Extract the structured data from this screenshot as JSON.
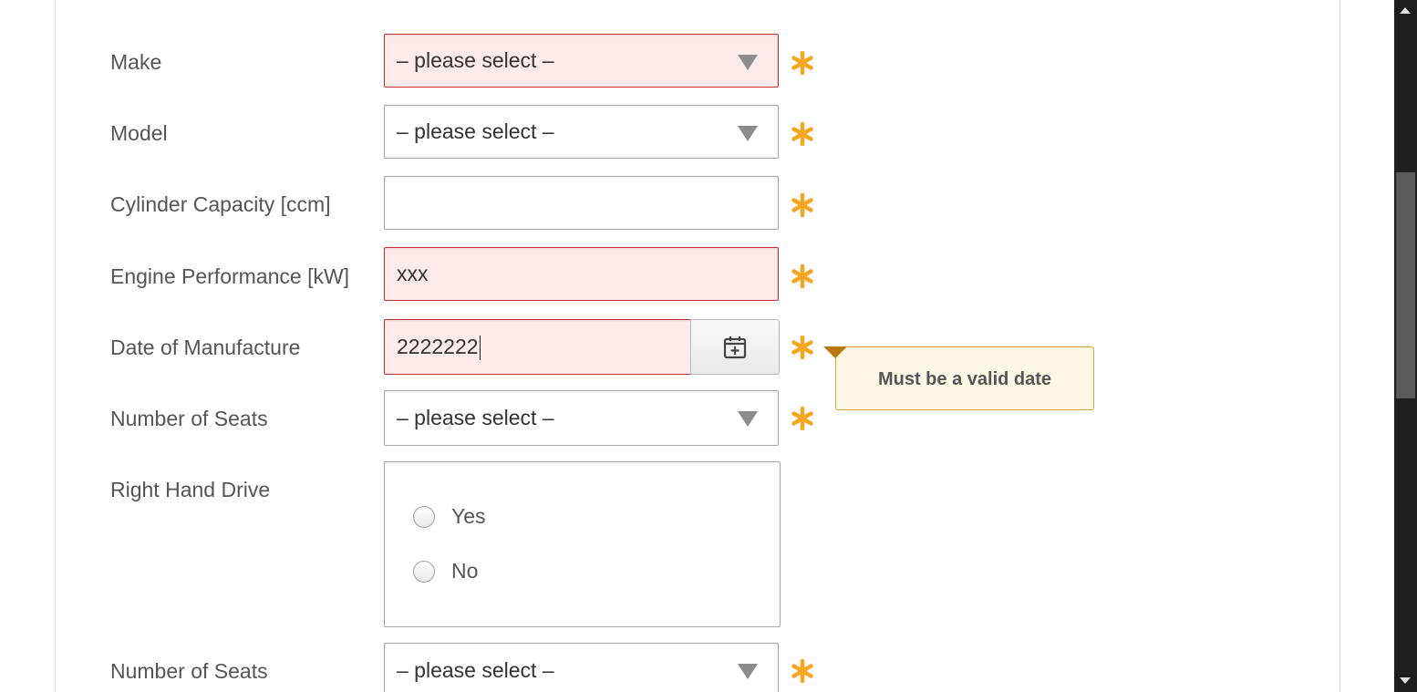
{
  "form": {
    "make": {
      "label": "Make",
      "value": "– please select –"
    },
    "model": {
      "label": "Model",
      "value": "– please select –"
    },
    "cylinder": {
      "label": "Cylinder Capacity [ccm]",
      "value": ""
    },
    "engine": {
      "label": "Engine Performance [kW]",
      "value": "xxx"
    },
    "date": {
      "label": "Date of Manufacture",
      "value": "2222222"
    },
    "seats": {
      "label": "Number of Seats",
      "value": "– please select –"
    },
    "rhd": {
      "label": "Right Hand Drive",
      "options": [
        {
          "label": "Yes"
        },
        {
          "label": "No"
        }
      ]
    },
    "seats2": {
      "label": "Number of Seats",
      "value": "– please select –"
    }
  },
  "tooltip": {
    "text": "Must be a valid date"
  },
  "icons": {
    "required": "asterisk-icon",
    "calendar": "calendar-plus-icon",
    "dropdown": "chevron-down-icon"
  },
  "colors": {
    "error_border": "#c9302c",
    "error_bg": "#fdeaea",
    "required": "#f5a623",
    "tooltip_border": "#d9a441",
    "tooltip_bg": "#fdf7e6"
  }
}
